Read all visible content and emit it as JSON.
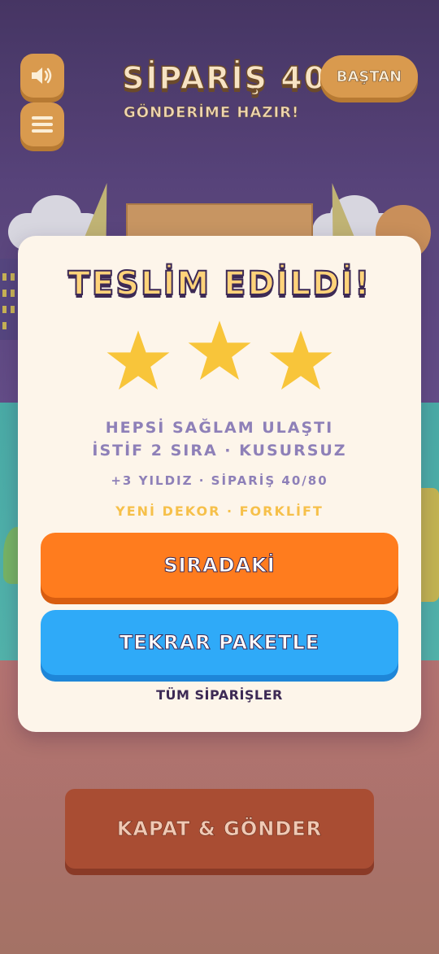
{
  "hud": {
    "order_title": "SİPARİŞ 40",
    "order_status": "GÖNDERİME HAZIR!",
    "restart_label": "BAŞTAN",
    "sound_icon": "speaker-icon",
    "menu_icon": "hamburger-menu-icon"
  },
  "modal": {
    "title": "TESLİM EDİLDİ!",
    "stars_earned": 3,
    "stars_total": 3,
    "status_line_1": "HEPSİ SAĞLAM ULAŞTI",
    "status_line_2": "İSTİF 2 SIRA · KUSURSUZ",
    "reward_line": "+3 YILDIZ · SİPARİŞ 40/80",
    "unlock_line": "YENİ DEKOR · FORKLİFT",
    "next_label": "SIRADAKİ",
    "repack_label": "TEKRAR PAKETLE",
    "all_orders_label": "TÜM SİPARİŞLER"
  },
  "bottom": {
    "ship_label": "KAPAT & GÖNDER"
  },
  "colors": {
    "star": "#f8c53a",
    "next_button": "#ff7c1e",
    "repack_button": "#2faaf8",
    "ship_button": "#a94d33",
    "hud_button": "#d99a4e"
  }
}
